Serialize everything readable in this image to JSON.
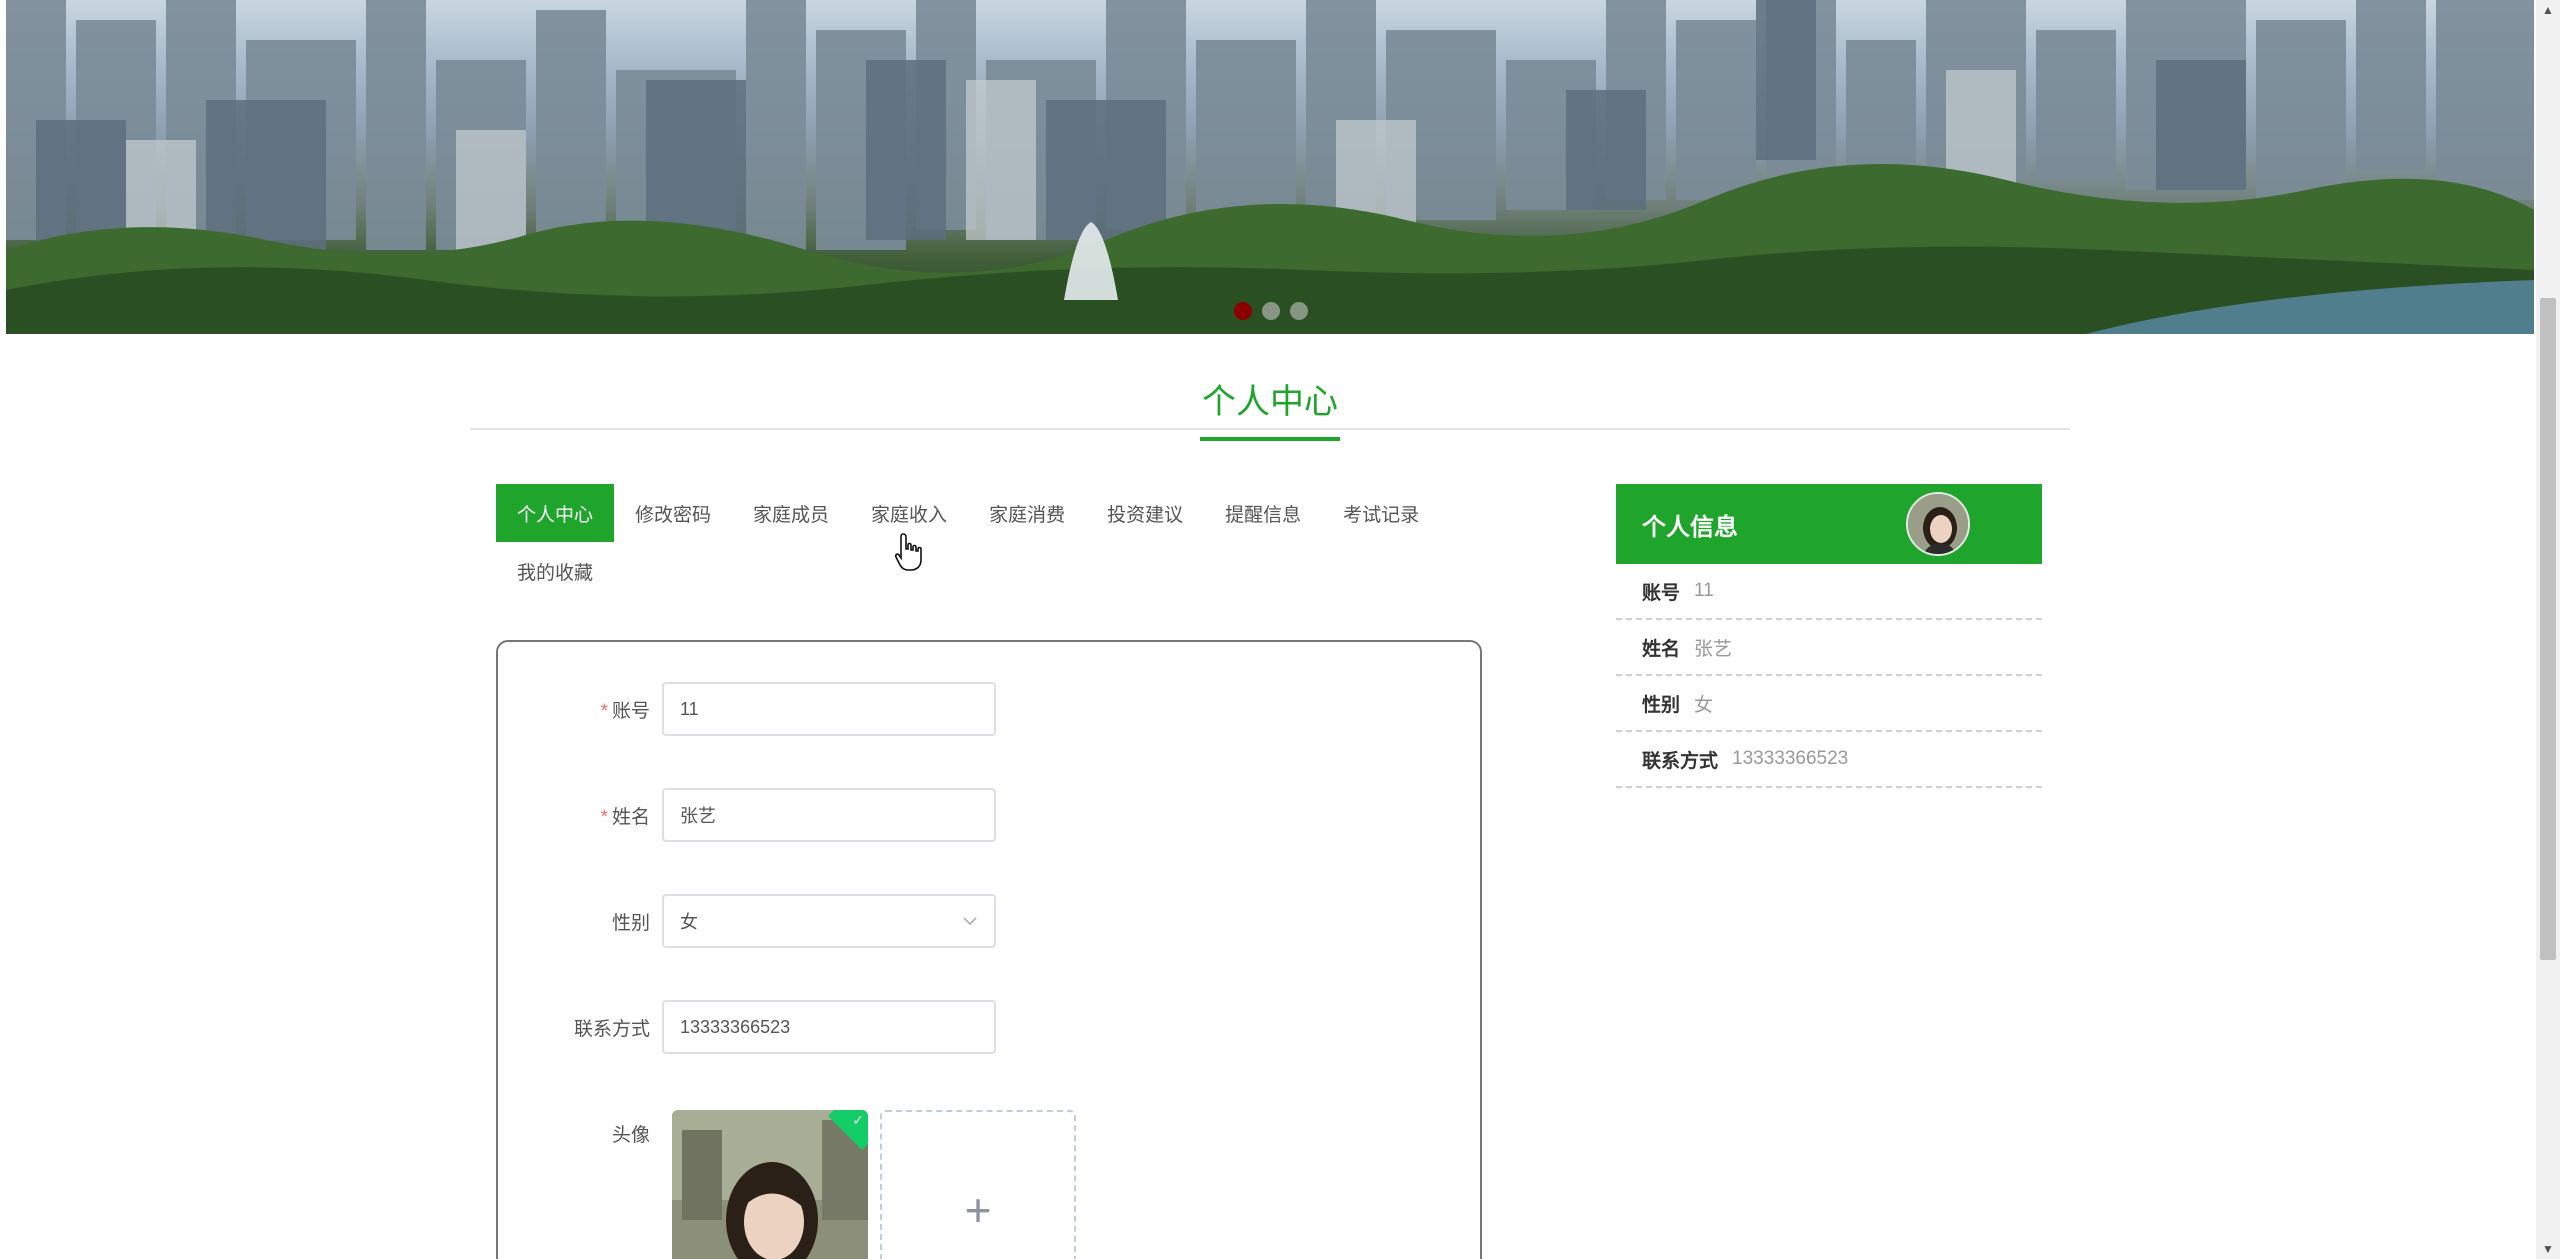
{
  "carousel": {
    "slide_count": 3,
    "active_index": 0,
    "active_color": "#8b0000"
  },
  "page_title": "个人中心",
  "accent_color": "#1fa52b",
  "tabs": [
    {
      "label": "个人中心",
      "active": true
    },
    {
      "label": "修改密码",
      "active": false
    },
    {
      "label": "家庭成员",
      "active": false
    },
    {
      "label": "家庭收入",
      "active": false
    },
    {
      "label": "家庭消费",
      "active": false
    },
    {
      "label": "投资建议",
      "active": false
    },
    {
      "label": "提醒信息",
      "active": false
    },
    {
      "label": "考试记录",
      "active": false
    },
    {
      "label": "我的收藏",
      "active": false
    }
  ],
  "form": {
    "account": {
      "label": "账号",
      "required_mark": "*",
      "value": "11"
    },
    "name": {
      "label": "姓名",
      "required_mark": "*",
      "value": "张艺"
    },
    "gender": {
      "label": "性别",
      "value": "女"
    },
    "phone": {
      "label": "联系方式",
      "value": "13333366523"
    },
    "avatar": {
      "label": "头像",
      "upload_icon": "plus-icon",
      "upload_symbol": "+",
      "status_icon": "check-icon",
      "status_symbol": "✓"
    }
  },
  "info_panel": {
    "title": "个人信息",
    "rows": [
      {
        "key": "账号",
        "value": "11"
      },
      {
        "key": "姓名",
        "value": "张艺"
      },
      {
        "key": "性别",
        "value": "女"
      },
      {
        "key": "联系方式",
        "value": "13333366523"
      }
    ]
  },
  "scrollbar": {
    "up_arrow": "▲",
    "down_arrow": "▼"
  }
}
